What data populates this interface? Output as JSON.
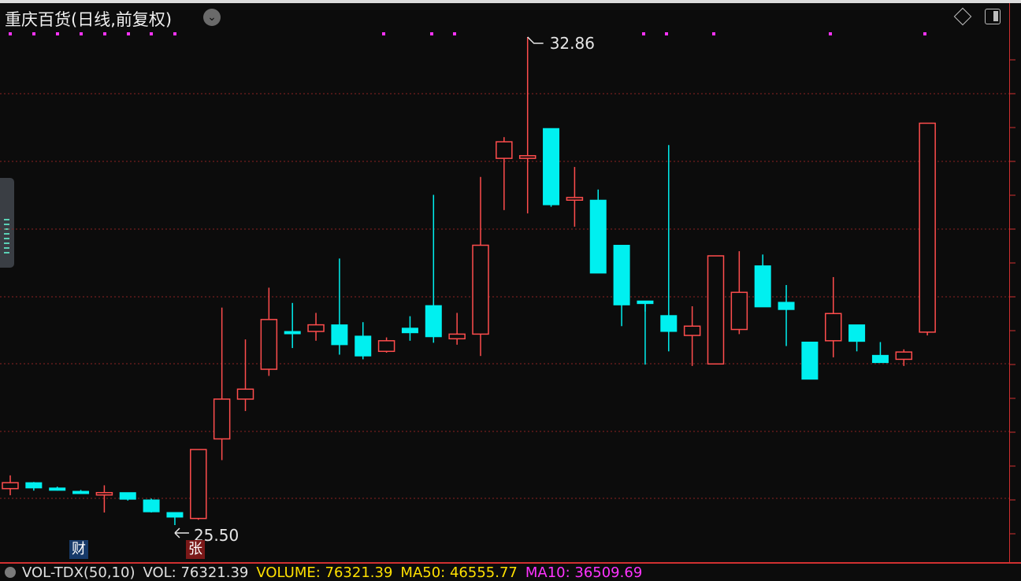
{
  "header": {
    "title": "重庆百货(日线,前复权)",
    "dropdown_icon": "chevron-down-icon"
  },
  "controls": {
    "diamond_icon": "diamond-icon",
    "panel_icon": "panel-toggle-icon"
  },
  "badges": {
    "cai": "财",
    "zhang": "张"
  },
  "volume_bar": {
    "name": "VOL-TDX(50,10)",
    "vol": "VOL: 76321.39",
    "volume": "VOLUME: 76321.39",
    "ma50": "MA50: 46555.77",
    "ma10": "MA10: 36509.69"
  },
  "colors": {
    "up": "#ff4d4d",
    "down": "#00f0f0",
    "grid": "#8b2222",
    "marker": "#ff33ff",
    "vol_label": "#e0e0e0",
    "volume": "#ffe000",
    "ma50": "#ffe000",
    "ma10": "#ff33ff"
  },
  "chart_data": {
    "type": "candlestick",
    "title": "重庆百货(日线,前复权)",
    "grid": true,
    "annotations": [
      {
        "label": "32.86",
        "type": "max_high",
        "index": 22
      },
      {
        "label": "25.50",
        "type": "min_low",
        "index": 7
      }
    ],
    "ohlc": [
      {
        "o": 26.05,
        "h": 26.25,
        "l": 25.95,
        "c": 26.14
      },
      {
        "o": 26.14,
        "h": 26.15,
        "l": 26.02,
        "c": 26.06
      },
      {
        "o": 26.06,
        "h": 26.08,
        "l": 26.02,
        "c": 26.04
      },
      {
        "o": 26.01,
        "h": 26.03,
        "l": 25.99,
        "c": 26.0
      },
      {
        "o": 25.97,
        "h": 26.1,
        "l": 25.69,
        "c": 25.99
      },
      {
        "o": 25.99,
        "h": 25.99,
        "l": 25.87,
        "c": 25.89
      },
      {
        "o": 25.88,
        "h": 25.9,
        "l": 25.69,
        "c": 25.7
      },
      {
        "o": 25.69,
        "h": 25.69,
        "l": 25.5,
        "c": 25.62
      },
      {
        "o": 25.6,
        "h": 26.64,
        "l": 25.58,
        "c": 26.64
      },
      {
        "o": 26.8,
        "h": 28.78,
        "l": 26.48,
        "c": 27.4
      },
      {
        "o": 27.4,
        "h": 28.3,
        "l": 27.22,
        "c": 27.55
      },
      {
        "o": 27.85,
        "h": 29.08,
        "l": 27.75,
        "c": 28.6
      },
      {
        "o": 28.42,
        "h": 28.85,
        "l": 28.17,
        "c": 28.4
      },
      {
        "o": 28.42,
        "h": 28.7,
        "l": 28.28,
        "c": 28.52
      },
      {
        "o": 28.52,
        "h": 29.52,
        "l": 28.07,
        "c": 28.22
      },
      {
        "o": 28.35,
        "h": 28.56,
        "l": 28.0,
        "c": 28.05
      },
      {
        "o": 28.12,
        "h": 28.33,
        "l": 28.1,
        "c": 28.28
      },
      {
        "o": 28.47,
        "h": 28.65,
        "l": 28.28,
        "c": 28.4
      },
      {
        "o": 28.81,
        "h": 30.48,
        "l": 28.25,
        "c": 28.34
      },
      {
        "o": 28.31,
        "h": 28.7,
        "l": 28.22,
        "c": 28.38
      },
      {
        "o": 28.38,
        "h": 30.75,
        "l": 28.05,
        "c": 29.72
      },
      {
        "o": 31.03,
        "h": 31.35,
        "l": 30.25,
        "c": 31.28
      },
      {
        "o": 31.03,
        "h": 32.86,
        "l": 30.2,
        "c": 31.07
      },
      {
        "o": 31.48,
        "h": 31.48,
        "l": 30.3,
        "c": 30.33
      },
      {
        "o": 30.4,
        "h": 30.9,
        "l": 30.0,
        "c": 30.44
      },
      {
        "o": 30.4,
        "h": 30.56,
        "l": 29.68,
        "c": 29.3
      },
      {
        "o": 29.72,
        "h": 29.72,
        "l": 28.5,
        "c": 28.82
      },
      {
        "o": 28.88,
        "h": 28.72,
        "l": 27.92,
        "c": 28.84
      },
      {
        "o": 28.66,
        "h": 31.23,
        "l": 28.12,
        "c": 28.42
      },
      {
        "o": 28.36,
        "h": 28.8,
        "l": 27.9,
        "c": 28.5
      },
      {
        "o": 27.93,
        "h": 29.39,
        "l": 28.27,
        "c": 29.56
      },
      {
        "o": 28.45,
        "h": 29.63,
        "l": 28.38,
        "c": 29.01
      },
      {
        "o": 29.41,
        "h": 29.58,
        "l": 28.85,
        "c": 28.79
      },
      {
        "o": 28.86,
        "h": 29.12,
        "l": 28.2,
        "c": 28.75
      },
      {
        "o": 28.26,
        "h": 28.26,
        "l": 27.78,
        "c": 27.7
      },
      {
        "o": 28.28,
        "h": 29.24,
        "l": 28.03,
        "c": 28.69
      },
      {
        "o": 28.52,
        "h": 28.49,
        "l": 28.12,
        "c": 28.27
      },
      {
        "o": 28.06,
        "h": 28.26,
        "l": 27.99,
        "c": 27.95
      },
      {
        "o": 28.0,
        "h": 28.15,
        "l": 27.9,
        "c": 28.11
      },
      {
        "o": 28.41,
        "h": 31.52,
        "l": 28.36,
        "c": 31.56
      }
    ]
  }
}
